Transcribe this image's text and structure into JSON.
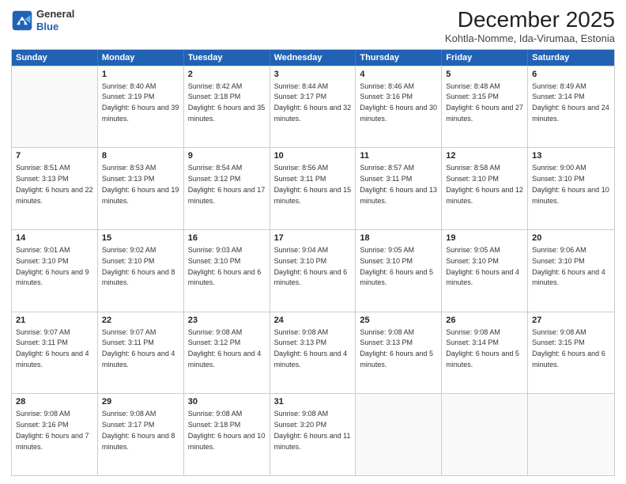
{
  "logo": {
    "general": "General",
    "blue": "Blue"
  },
  "header": {
    "title": "December 2025",
    "subtitle": "Kohtla-Nomme, Ida-Virumaa, Estonia"
  },
  "weekdays": [
    "Sunday",
    "Monday",
    "Tuesday",
    "Wednesday",
    "Thursday",
    "Friday",
    "Saturday"
  ],
  "rows": [
    [
      {
        "day": "",
        "sunrise": "",
        "sunset": "",
        "daylight": ""
      },
      {
        "day": "1",
        "sunrise": "Sunrise: 8:40 AM",
        "sunset": "Sunset: 3:19 PM",
        "daylight": "Daylight: 6 hours and 39 minutes."
      },
      {
        "day": "2",
        "sunrise": "Sunrise: 8:42 AM",
        "sunset": "Sunset: 3:18 PM",
        "daylight": "Daylight: 6 hours and 35 minutes."
      },
      {
        "day": "3",
        "sunrise": "Sunrise: 8:44 AM",
        "sunset": "Sunset: 3:17 PM",
        "daylight": "Daylight: 6 hours and 32 minutes."
      },
      {
        "day": "4",
        "sunrise": "Sunrise: 8:46 AM",
        "sunset": "Sunset: 3:16 PM",
        "daylight": "Daylight: 6 hours and 30 minutes."
      },
      {
        "day": "5",
        "sunrise": "Sunrise: 8:48 AM",
        "sunset": "Sunset: 3:15 PM",
        "daylight": "Daylight: 6 hours and 27 minutes."
      },
      {
        "day": "6",
        "sunrise": "Sunrise: 8:49 AM",
        "sunset": "Sunset: 3:14 PM",
        "daylight": "Daylight: 6 hours and 24 minutes."
      }
    ],
    [
      {
        "day": "7",
        "sunrise": "Sunrise: 8:51 AM",
        "sunset": "Sunset: 3:13 PM",
        "daylight": "Daylight: 6 hours and 22 minutes."
      },
      {
        "day": "8",
        "sunrise": "Sunrise: 8:53 AM",
        "sunset": "Sunset: 3:13 PM",
        "daylight": "Daylight: 6 hours and 19 minutes."
      },
      {
        "day": "9",
        "sunrise": "Sunrise: 8:54 AM",
        "sunset": "Sunset: 3:12 PM",
        "daylight": "Daylight: 6 hours and 17 minutes."
      },
      {
        "day": "10",
        "sunrise": "Sunrise: 8:56 AM",
        "sunset": "Sunset: 3:11 PM",
        "daylight": "Daylight: 6 hours and 15 minutes."
      },
      {
        "day": "11",
        "sunrise": "Sunrise: 8:57 AM",
        "sunset": "Sunset: 3:11 PM",
        "daylight": "Daylight: 6 hours and 13 minutes."
      },
      {
        "day": "12",
        "sunrise": "Sunrise: 8:58 AM",
        "sunset": "Sunset: 3:10 PM",
        "daylight": "Daylight: 6 hours and 12 minutes."
      },
      {
        "day": "13",
        "sunrise": "Sunrise: 9:00 AM",
        "sunset": "Sunset: 3:10 PM",
        "daylight": "Daylight: 6 hours and 10 minutes."
      }
    ],
    [
      {
        "day": "14",
        "sunrise": "Sunrise: 9:01 AM",
        "sunset": "Sunset: 3:10 PM",
        "daylight": "Daylight: 6 hours and 9 minutes."
      },
      {
        "day": "15",
        "sunrise": "Sunrise: 9:02 AM",
        "sunset": "Sunset: 3:10 PM",
        "daylight": "Daylight: 6 hours and 8 minutes."
      },
      {
        "day": "16",
        "sunrise": "Sunrise: 9:03 AM",
        "sunset": "Sunset: 3:10 PM",
        "daylight": "Daylight: 6 hours and 6 minutes."
      },
      {
        "day": "17",
        "sunrise": "Sunrise: 9:04 AM",
        "sunset": "Sunset: 3:10 PM",
        "daylight": "Daylight: 6 hours and 6 minutes."
      },
      {
        "day": "18",
        "sunrise": "Sunrise: 9:05 AM",
        "sunset": "Sunset: 3:10 PM",
        "daylight": "Daylight: 6 hours and 5 minutes."
      },
      {
        "day": "19",
        "sunrise": "Sunrise: 9:05 AM",
        "sunset": "Sunset: 3:10 PM",
        "daylight": "Daylight: 6 hours and 4 minutes."
      },
      {
        "day": "20",
        "sunrise": "Sunrise: 9:06 AM",
        "sunset": "Sunset: 3:10 PM",
        "daylight": "Daylight: 6 hours and 4 minutes."
      }
    ],
    [
      {
        "day": "21",
        "sunrise": "Sunrise: 9:07 AM",
        "sunset": "Sunset: 3:11 PM",
        "daylight": "Daylight: 6 hours and 4 minutes."
      },
      {
        "day": "22",
        "sunrise": "Sunrise: 9:07 AM",
        "sunset": "Sunset: 3:11 PM",
        "daylight": "Daylight: 6 hours and 4 minutes."
      },
      {
        "day": "23",
        "sunrise": "Sunrise: 9:08 AM",
        "sunset": "Sunset: 3:12 PM",
        "daylight": "Daylight: 6 hours and 4 minutes."
      },
      {
        "day": "24",
        "sunrise": "Sunrise: 9:08 AM",
        "sunset": "Sunset: 3:13 PM",
        "daylight": "Daylight: 6 hours and 4 minutes."
      },
      {
        "day": "25",
        "sunrise": "Sunrise: 9:08 AM",
        "sunset": "Sunset: 3:13 PM",
        "daylight": "Daylight: 6 hours and 5 minutes."
      },
      {
        "day": "26",
        "sunrise": "Sunrise: 9:08 AM",
        "sunset": "Sunset: 3:14 PM",
        "daylight": "Daylight: 6 hours and 5 minutes."
      },
      {
        "day": "27",
        "sunrise": "Sunrise: 9:08 AM",
        "sunset": "Sunset: 3:15 PM",
        "daylight": "Daylight: 6 hours and 6 minutes."
      }
    ],
    [
      {
        "day": "28",
        "sunrise": "Sunrise: 9:08 AM",
        "sunset": "Sunset: 3:16 PM",
        "daylight": "Daylight: 6 hours and 7 minutes."
      },
      {
        "day": "29",
        "sunrise": "Sunrise: 9:08 AM",
        "sunset": "Sunset: 3:17 PM",
        "daylight": "Daylight: 6 hours and 8 minutes."
      },
      {
        "day": "30",
        "sunrise": "Sunrise: 9:08 AM",
        "sunset": "Sunset: 3:18 PM",
        "daylight": "Daylight: 6 hours and 10 minutes."
      },
      {
        "day": "31",
        "sunrise": "Sunrise: 9:08 AM",
        "sunset": "Sunset: 3:20 PM",
        "daylight": "Daylight: 6 hours and 11 minutes."
      },
      {
        "day": "",
        "sunrise": "",
        "sunset": "",
        "daylight": ""
      },
      {
        "day": "",
        "sunrise": "",
        "sunset": "",
        "daylight": ""
      },
      {
        "day": "",
        "sunrise": "",
        "sunset": "",
        "daylight": ""
      }
    ]
  ]
}
